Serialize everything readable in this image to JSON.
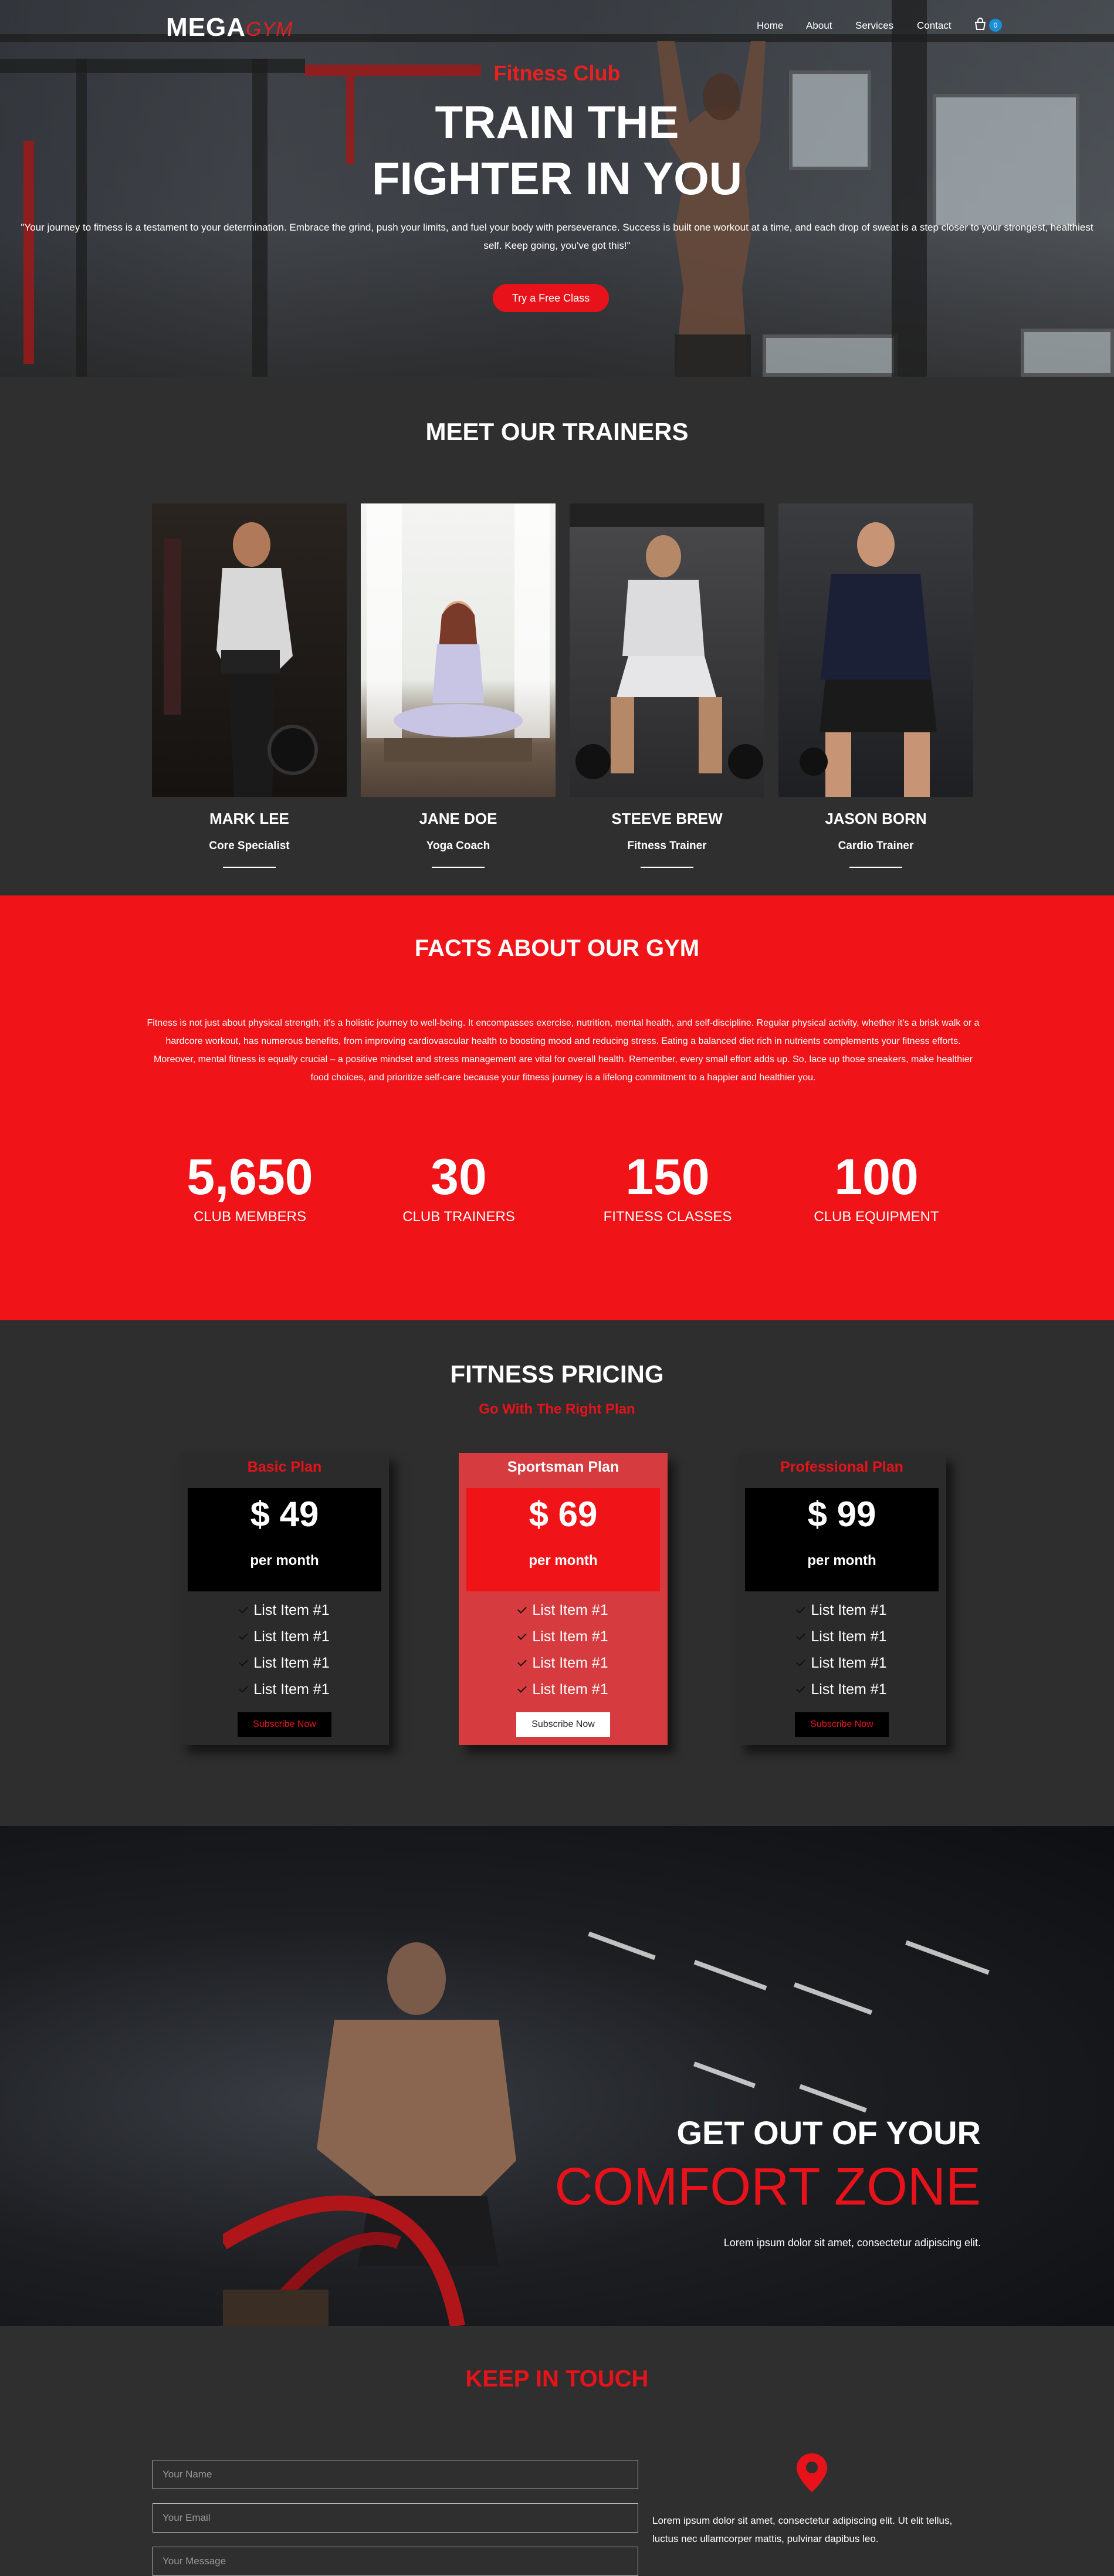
{
  "nav": {
    "logo_main": "MEGA",
    "logo_accent": "GYM",
    "links": [
      "Home",
      "About",
      "Services",
      "Contact"
    ],
    "cart_count": "0"
  },
  "hero": {
    "kicker": "Fitness Club",
    "title_line1": "TRAIN THE",
    "title_line2": "FIGHTER IN YOU",
    "quote": "\"Your journey to fitness is a testament to your determination. Embrace the grind, push your limits, and fuel your body with perseverance. Success is built one workout at a time, and each drop of sweat is a step closer to your strongest, healthiest self. Keep going, you've got this!\"",
    "cta": "Try a Free Class"
  },
  "trainers": {
    "title": "MEET OUR TRAINERS",
    "items": [
      {
        "name": "MARK LEE",
        "role": "Core Specialist"
      },
      {
        "name": "JANE DOE",
        "role": "Yoga Coach"
      },
      {
        "name": "STEEVE BREW",
        "role": "Fitness Trainer"
      },
      {
        "name": "JASON BORN",
        "role": "Cardio Trainer"
      }
    ]
  },
  "facts": {
    "title": "FACTS ABOUT OUR GYM",
    "text": "Fitness is not just about physical strength; it's a holistic journey to well-being. It encompasses exercise, nutrition, mental health, and self-discipline. Regular physical activity, whether it's a brisk walk or a hardcore workout, has numerous benefits, from improving cardiovascular health to boosting mood and reducing stress. Eating a balanced diet rich in nutrients complements your fitness efforts. Moreover, mental fitness is equally crucial – a positive mindset and stress management are vital for overall health. Remember, every small effort adds up. So, lace up those sneakers, make healthier food choices, and prioritize self-care because your fitness journey is a lifelong commitment to a happier and healthier you.",
    "stats": [
      {
        "value": "5,650",
        "label": "CLUB MEMBERS"
      },
      {
        "value": "30",
        "label": "CLUB TRAINERS"
      },
      {
        "value": "150",
        "label": "FITNESS CLASSES"
      },
      {
        "value": "100",
        "label": "CLUB EQUIPMENT"
      }
    ]
  },
  "pricing": {
    "title": "FITNESS PRICING",
    "subtitle": "Go With The Right Plan",
    "plans": [
      {
        "name": "Basic Plan",
        "price": "$ 49",
        "per": "per month",
        "items": [
          "List Item #1",
          "List Item #1",
          "List Item #1",
          "List Item #1"
        ],
        "button": "Subscribe Now"
      },
      {
        "name": "Sportsman Plan",
        "price": "$ 69",
        "per": "per month",
        "items": [
          "List Item #1",
          "List Item #1",
          "List Item #1",
          "List Item #1"
        ],
        "button": "Subscribe Now"
      },
      {
        "name": "Professional Plan",
        "price": "$ 99",
        "per": "per month",
        "items": [
          "List Item #1",
          "List Item #1",
          "List Item #1",
          "List Item #1"
        ],
        "button": "Subscribe Now"
      }
    ]
  },
  "comfort": {
    "line1": "GET OUT OF YOUR",
    "line2": "COMFORT ZONE",
    "line3": "Lorem ipsum dolor sit amet, consectetur adipiscing elit."
  },
  "contact": {
    "title": "KEEP IN TOUCH",
    "name_placeholder": "Your Name",
    "email_placeholder": "Your Email",
    "message_placeholder": "Your Message",
    "text": "Lorem ipsum dolor sit amet, consectetur adipiscing elit. Ut elit tellus, luctus nec ullamcorper mattis, pulvinar dapibus leo."
  },
  "colors": {
    "accent": "#e8131a",
    "facts_bg": "#f01317",
    "dark_bg": "#2e2e2e",
    "badge": "#1a8fd8"
  }
}
